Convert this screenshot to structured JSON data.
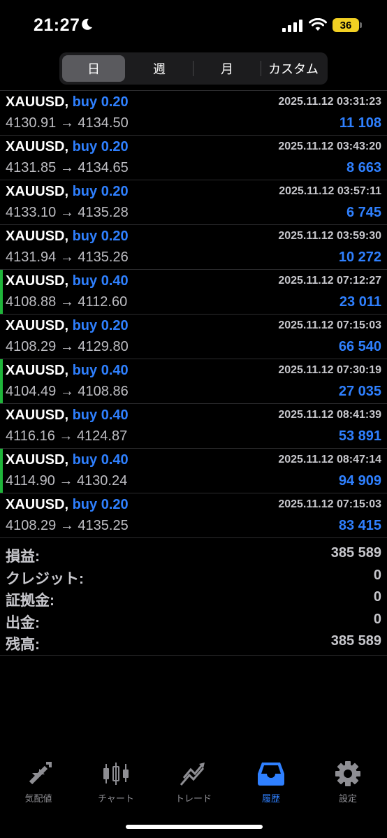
{
  "status": {
    "time": "21:27",
    "battery": "36"
  },
  "tabs_segment": [
    "日",
    "週",
    "月",
    "カスタム"
  ],
  "trades": [
    {
      "symbol": "XAUUSD,",
      "direction": "buy 0.20",
      "datetime": "2025.11.12 03:31:23",
      "open": "4130.91",
      "close": "4134.50",
      "arrow": "→",
      "profit": "11 108",
      "marked": false
    },
    {
      "symbol": "XAUUSD,",
      "direction": "buy 0.20",
      "datetime": "2025.11.12 03:43:20",
      "open": "4131.85",
      "close": "4134.65",
      "arrow": "→",
      "profit": "8 663",
      "marked": false
    },
    {
      "symbol": "XAUUSD,",
      "direction": "buy 0.20",
      "datetime": "2025.11.12 03:57:11",
      "open": "4133.10",
      "close": "4135.28",
      "arrow": "→",
      "profit": "6 745",
      "marked": false
    },
    {
      "symbol": "XAUUSD,",
      "direction": "buy 0.20",
      "datetime": "2025.11.12 03:59:30",
      "open": "4131.94",
      "close": "4135.26",
      "arrow": "→",
      "profit": "10 272",
      "marked": false
    },
    {
      "symbol": "XAUUSD,",
      "direction": "buy 0.40",
      "datetime": "2025.11.12 07:12:27",
      "open": "4108.88",
      "close": "4112.60",
      "arrow": "→",
      "profit": "23 011",
      "marked": true
    },
    {
      "symbol": "XAUUSD,",
      "direction": "buy 0.20",
      "datetime": "2025.11.12 07:15:03",
      "open": "4108.29",
      "close": "4129.80",
      "arrow": "→",
      "profit": "66 540",
      "marked": false
    },
    {
      "symbol": "XAUUSD,",
      "direction": "buy 0.40",
      "datetime": "2025.11.12 07:30:19",
      "open": "4104.49",
      "close": "4108.86",
      "arrow": "→",
      "profit": "27 035",
      "marked": true
    },
    {
      "symbol": "XAUUSD,",
      "direction": "buy 0.40",
      "datetime": "2025.11.12 08:41:39",
      "open": "4116.16",
      "close": "4124.87",
      "arrow": "→",
      "profit": "53 891",
      "marked": false
    },
    {
      "symbol": "XAUUSD,",
      "direction": "buy 0.40",
      "datetime": "2025.11.12 08:47:14",
      "open": "4114.90",
      "close": "4130.24",
      "arrow": "→",
      "profit": "94 909",
      "marked": true
    },
    {
      "symbol": "XAUUSD,",
      "direction": "buy 0.20",
      "datetime": "2025.11.12 07:15:03",
      "open": "4108.29",
      "close": "4135.25",
      "arrow": "→",
      "profit": "83 415",
      "marked": false
    }
  ],
  "summary": [
    {
      "label": "損益:",
      "value": "385 589"
    },
    {
      "label": "クレジット:",
      "value": "0"
    },
    {
      "label": "証拠金:",
      "value": "0"
    },
    {
      "label": "出金:",
      "value": "0"
    },
    {
      "label": "残高:",
      "value": "385 589"
    }
  ],
  "tabbar": [
    {
      "label": "気配値",
      "icon": "quotes-icon",
      "active": false
    },
    {
      "label": "チャート",
      "icon": "candlestick-chart-icon",
      "active": false
    },
    {
      "label": "トレード",
      "icon": "trade-icon",
      "active": false
    },
    {
      "label": "履歴",
      "icon": "history-inbox-icon",
      "active": true
    },
    {
      "label": "設定",
      "icon": "gear-icon",
      "active": false
    }
  ],
  "colors": {
    "accent": "#2f80ff",
    "marker": "#1fb53a",
    "background": "#000000"
  }
}
